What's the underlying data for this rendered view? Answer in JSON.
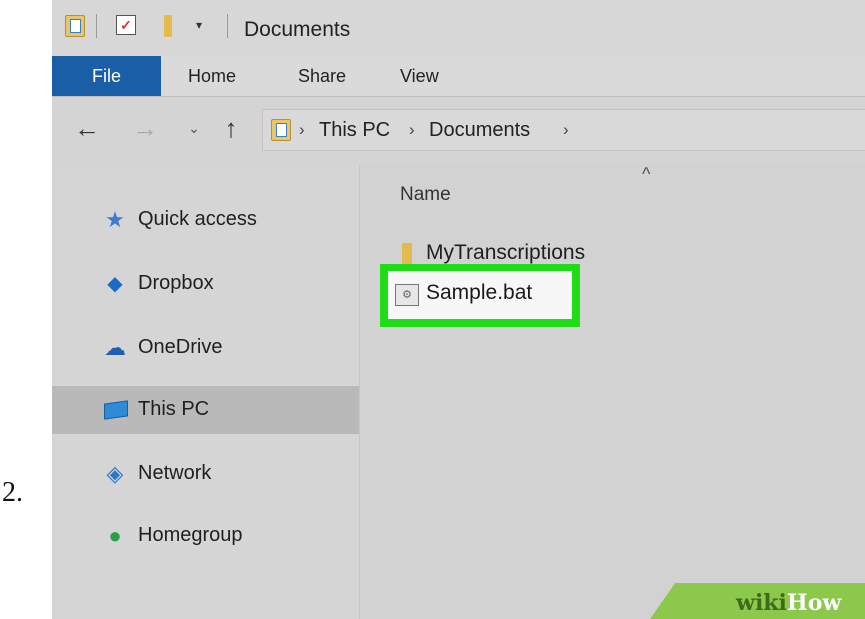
{
  "step": {
    "number": "2."
  },
  "window": {
    "title": "Documents"
  },
  "quick_access": {
    "icons": [
      "documents-icon",
      "properties-check-icon",
      "new-folder-icon",
      "customize-dropdown-icon"
    ],
    "dropdown_glyph": "▾"
  },
  "ribbon": {
    "tabs": [
      {
        "label": "File",
        "active": true
      },
      {
        "label": "Home"
      },
      {
        "label": "Share"
      },
      {
        "label": "View"
      }
    ],
    "file_tab_color": "#1a5ea8"
  },
  "nav": {
    "back": "←",
    "forward": "→",
    "recent": "⌄",
    "up": "↑",
    "separator": "›",
    "breadcrumbs": [
      "This PC",
      "Documents"
    ]
  },
  "sidebar": {
    "items": [
      {
        "label": "Quick access",
        "icon": "star-icon"
      },
      {
        "label": "Dropbox",
        "icon": "dropbox-icon"
      },
      {
        "label": "OneDrive",
        "icon": "cloud-icon"
      },
      {
        "label": "This PC",
        "icon": "computer-icon",
        "selected": true
      },
      {
        "label": "Network",
        "icon": "network-icon"
      },
      {
        "label": "Homegroup",
        "icon": "homegroup-icon"
      }
    ]
  },
  "main": {
    "column_header": "Name",
    "sort_glyph": "^",
    "files": [
      {
        "name": "MyTranscriptions",
        "type": "folder"
      },
      {
        "name": "Sample.bat",
        "type": "batch-file",
        "highlighted": true
      }
    ],
    "highlight_color": "#1fdc17"
  },
  "watermark": {
    "wiki": "wiki",
    "how": "How"
  }
}
